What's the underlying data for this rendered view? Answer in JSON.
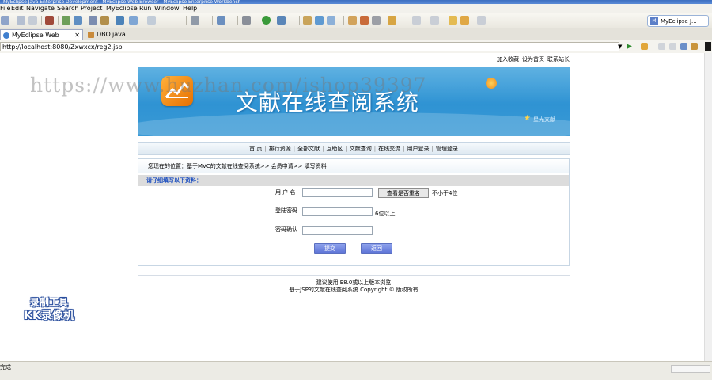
{
  "window": {
    "title": "MyEclipse Java Enterprise Development - MyEclipse Web Browser - MyEclipse Enterprise Workbench"
  },
  "menu": {
    "items": [
      "File",
      "Edit",
      "Navigate",
      "Search",
      "Project",
      "MyEclipse",
      "Run",
      "Window",
      "Help"
    ]
  },
  "perspective": {
    "icon": "M",
    "label": "MyEclipse J..."
  },
  "tabs": [
    {
      "label": "MyEclipse Web Browser",
      "icon": "globe-icon",
      "active": true
    },
    {
      "label": "DBO.java",
      "icon": "java-file-icon",
      "active": false
    }
  ],
  "browser": {
    "url": "http://localhost:8080/Zxwxcx/reg2.jsp"
  },
  "site": {
    "toplinks": [
      "加入收藏",
      "设为首页",
      "联系站长"
    ],
    "title": "文献在线查阅系统",
    "slogan": "星光文献",
    "nav": [
      "首 页",
      "排行资源",
      "全部文献",
      "互助区",
      "文献查询",
      "在线交流",
      "用户登录",
      "管理登录"
    ],
    "breadcrumb": "您现在的位置：基于MVC的文献在线查阅系统>> 会员申请>> 填写资料",
    "form_heading": "请仔细填写以下资料：",
    "username_label": "用 户 名",
    "check_button": "查看是否重名",
    "username_hint": "不小于4位",
    "password_label": "登陆密码",
    "password_hint": "6位以上",
    "confirm_label": "密码确认",
    "submit_button": "提交",
    "back_button": "返回",
    "footer_line1": "建议使用IE8.0或以上版本浏览",
    "footer_line2": "基于JSP的文献在线查阅系统 Copyright © 版权所有"
  },
  "overlay": {
    "watermark": "https://www.huzhan.com/ishop39397",
    "stamp_line1": "录制工具",
    "stamp_line2": "KK录像机"
  },
  "status": {
    "text": "完成"
  },
  "colors": {
    "banner": "#3a9ad6",
    "form_heading": "#1d4fbf",
    "button": "#6a80dd"
  }
}
